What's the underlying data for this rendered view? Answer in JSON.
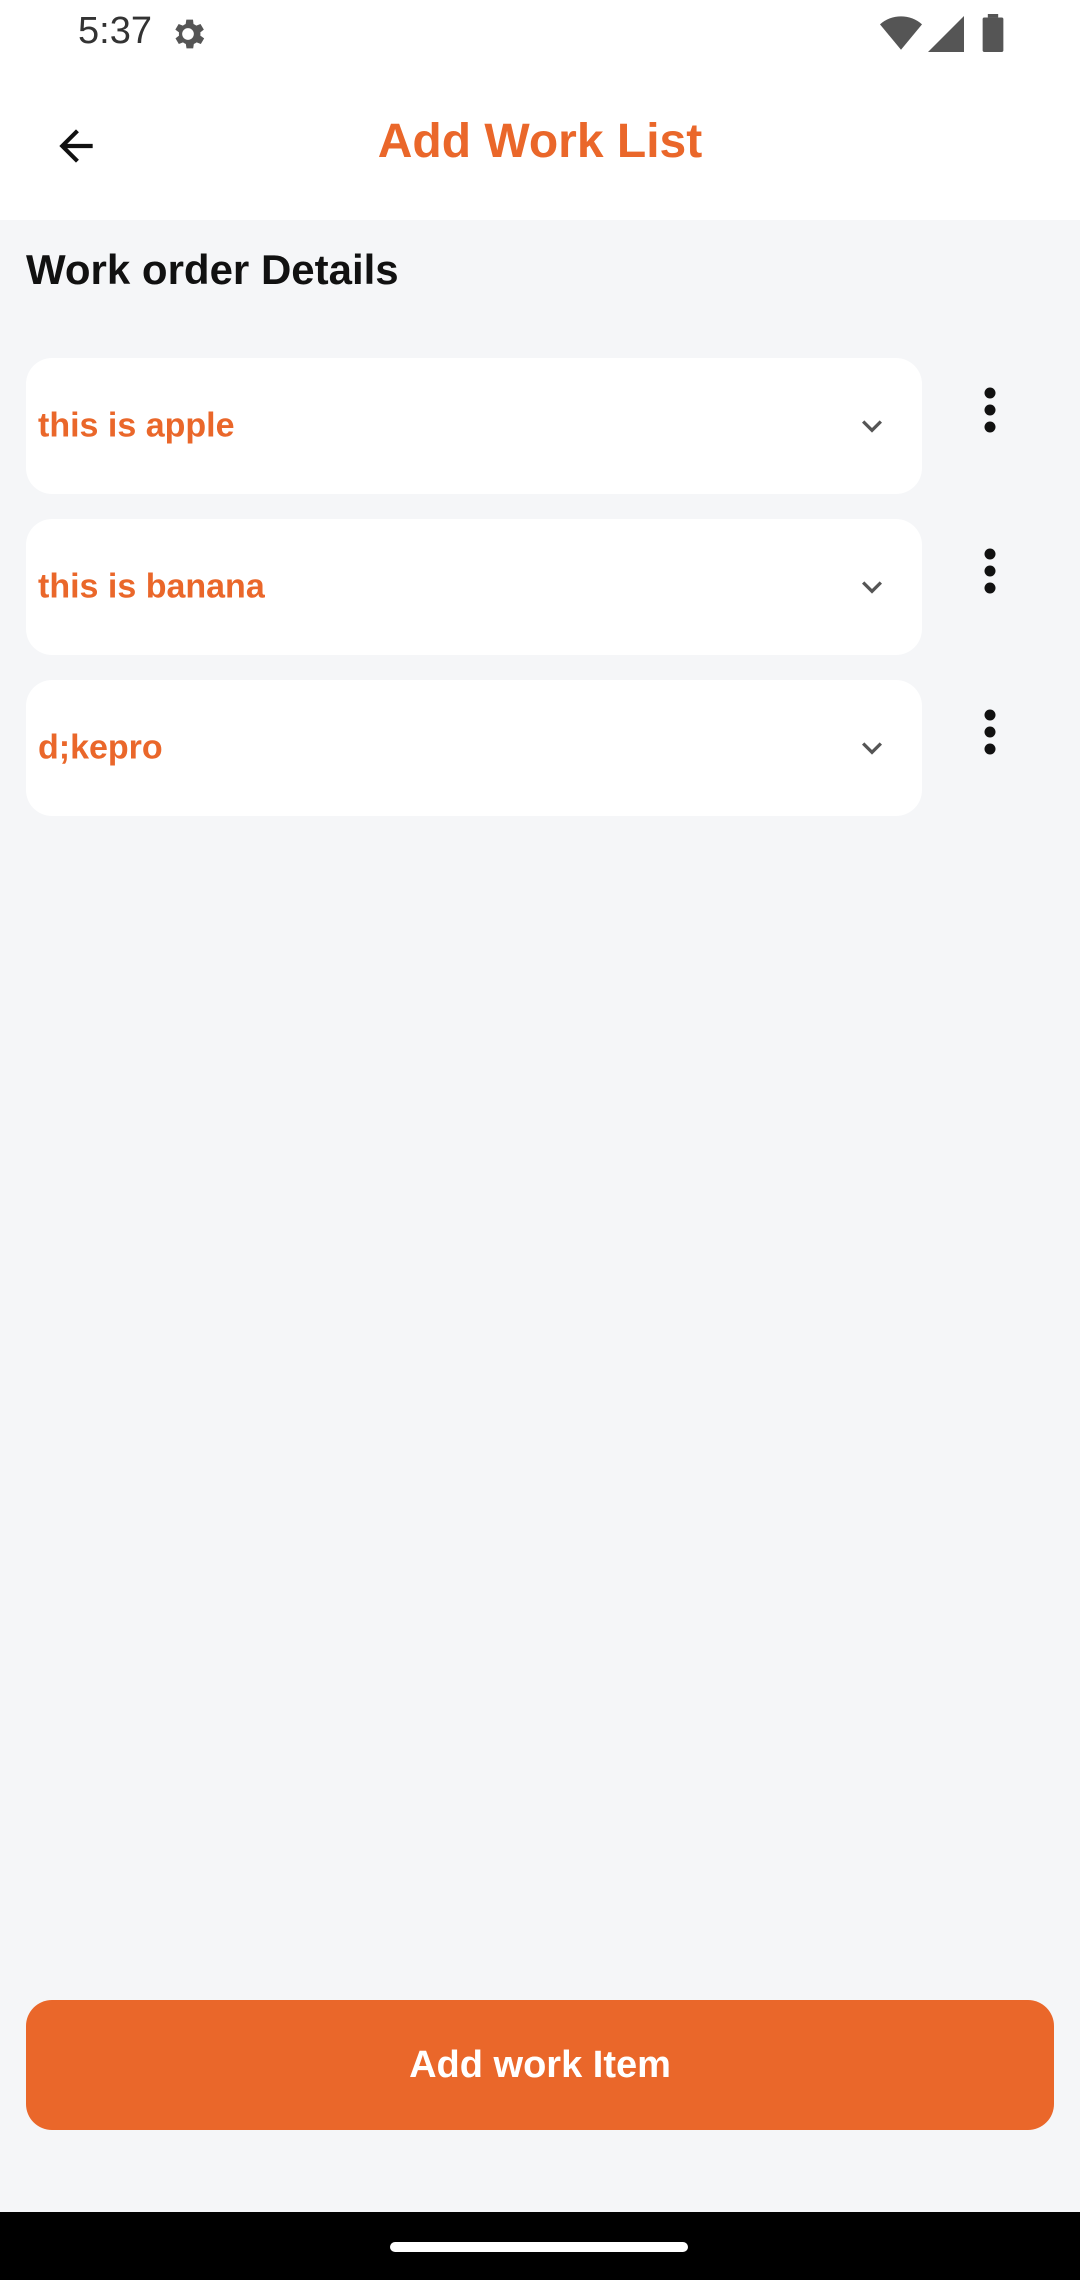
{
  "status_bar": {
    "time": "5:37",
    "icons": [
      "settings-icon",
      "wifi-icon",
      "signal-icon",
      "battery-icon"
    ]
  },
  "app_bar": {
    "title": "Add Work List",
    "back_icon": "arrow-back-icon"
  },
  "section": {
    "title": "Work order Details"
  },
  "work_items": [
    {
      "label": "this is apple"
    },
    {
      "label": "this is banana"
    },
    {
      "label": "d;kepro"
    }
  ],
  "actions": {
    "add_item_label": "Add work Item"
  },
  "colors": {
    "accent": "#ea672a",
    "background": "#f5f6f8",
    "card": "#ffffff"
  }
}
